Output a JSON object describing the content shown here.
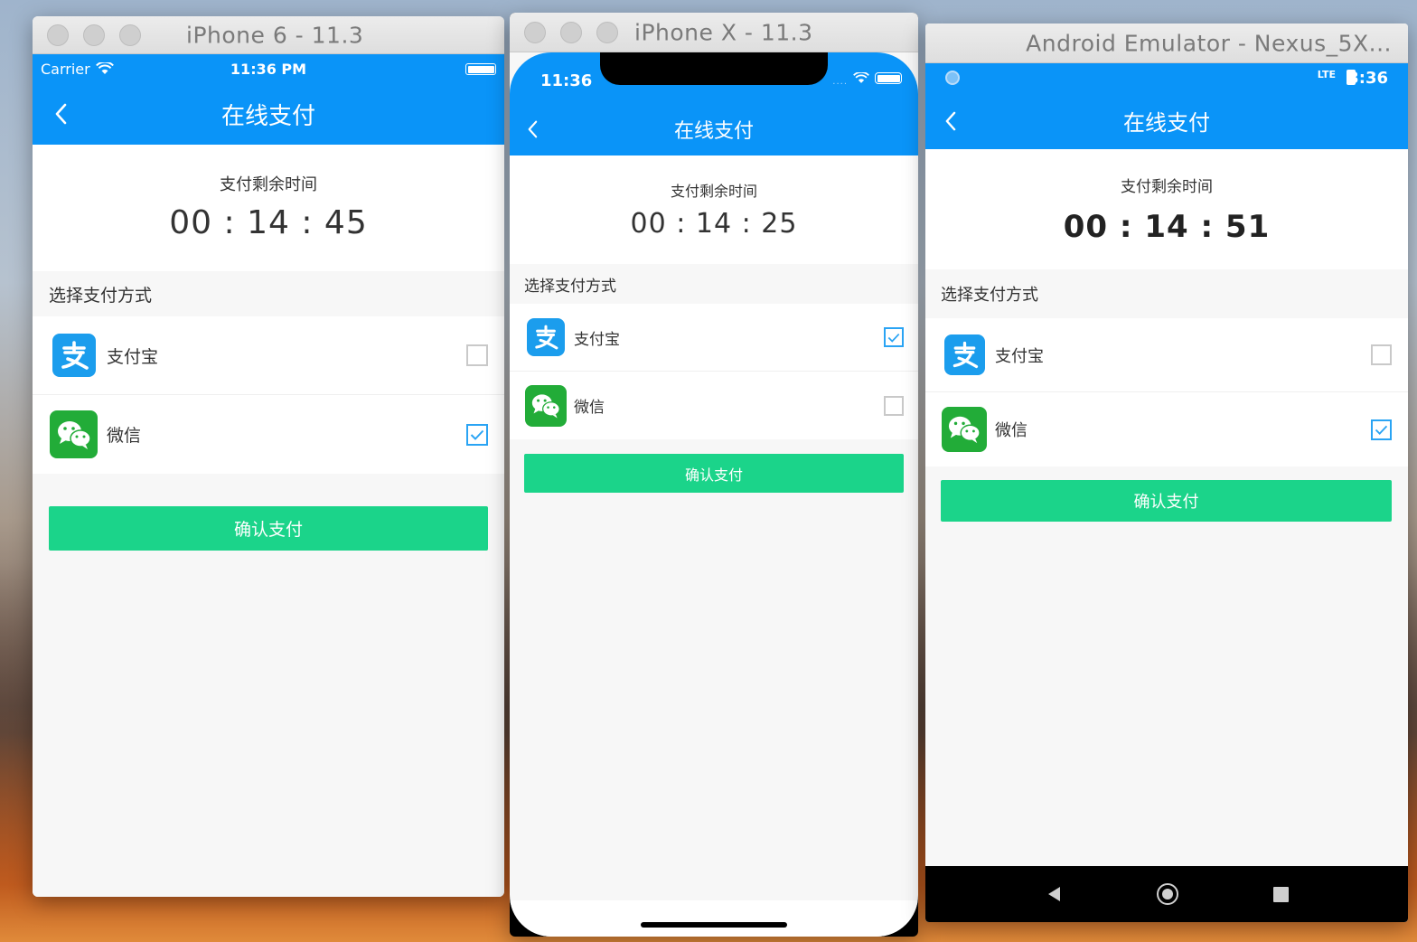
{
  "sim1": {
    "window_title": "iPhone 6 - 11.3",
    "status": {
      "carrier": "Carrier",
      "time": "11:36 PM"
    },
    "nav_title": "在线支付",
    "timer": {
      "label": "支付剩余时间",
      "value": "00 : 14 : 45"
    },
    "section_title": "选择支付方式",
    "methods": [
      {
        "label": "支付宝",
        "checked": false
      },
      {
        "label": "微信",
        "checked": true
      }
    ],
    "confirm_label": "确认支付"
  },
  "sim2": {
    "window_title": "iPhone X - 11.3",
    "status": {
      "time": "11:36"
    },
    "nav_title": "在线支付",
    "timer": {
      "label": "支付剩余时间",
      "value": "00 : 14 : 25"
    },
    "section_title": "选择支付方式",
    "methods": [
      {
        "label": "支付宝",
        "checked": true
      },
      {
        "label": "微信",
        "checked": false
      }
    ],
    "confirm_label": "确认支付"
  },
  "sim3": {
    "window_title": "Android Emulator - Nexus_5X...",
    "status": {
      "network": "LTE",
      "time": "3:36"
    },
    "nav_title": "在线支付",
    "timer": {
      "label": "支付剩余时间",
      "value": "00 : 14 : 51"
    },
    "section_title": "选择支付方式",
    "methods": [
      {
        "label": "支付宝",
        "checked": false
      },
      {
        "label": "微信",
        "checked": true
      }
    ],
    "confirm_label": "确认支付"
  },
  "colors": {
    "primary_blue": "#0a94f8",
    "confirm_green": "#1bd48a",
    "alipay_blue": "#1b9ded",
    "wechat_green": "#22ac38",
    "checkbox_checked": "#2aa4f4"
  },
  "icons": [
    "back-arrow-icon",
    "wifi-icon",
    "battery-icon",
    "alipay-icon",
    "wechat-icon",
    "checkmark-icon",
    "android-back-icon",
    "android-home-icon",
    "android-recents-icon"
  ]
}
